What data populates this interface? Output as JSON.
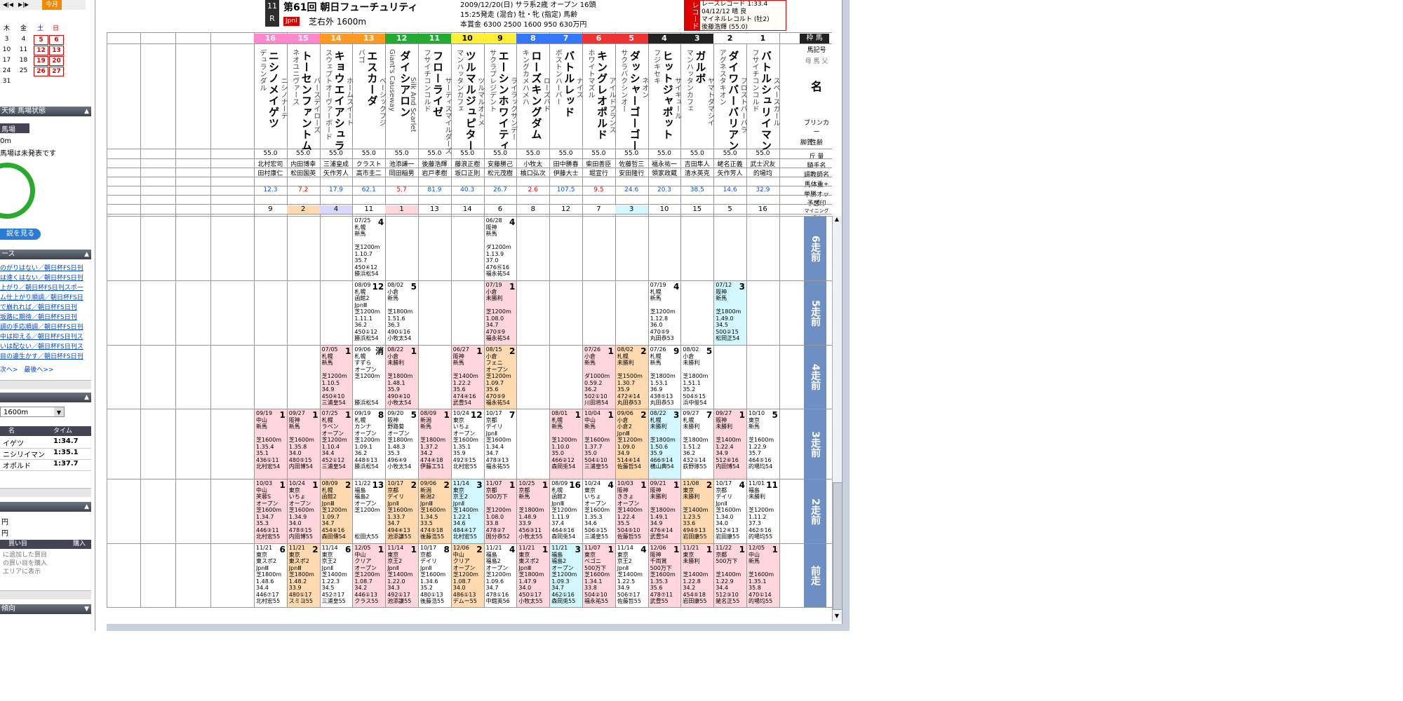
{
  "sidebar": {
    "calendar": {
      "today_label": "今月",
      "weekdays": [
        "木",
        "金",
        "土",
        "日"
      ],
      "rows": [
        [
          "3",
          "4",
          "5",
          "6"
        ],
        [
          "10",
          "11",
          "12",
          "13"
        ],
        [
          "17",
          "18",
          "19",
          "20"
        ],
        [
          "24",
          "25",
          "26",
          "27"
        ],
        [
          "31",
          "",
          "",
          ""
        ]
      ]
    },
    "track_status": {
      "title": "天候 馬場状態",
      "line1": "馬場",
      "line2": "0m",
      "line3": "馬場は未発表です",
      "video_button": "説を見る"
    },
    "news": {
      "title": "ース",
      "items": [
        "のがりはない／朝日杯FS日刊",
        "は速くはない／朝日杯FS日刊",
        "上がり／朝日杯FS日刊スポー",
        "ム仕上がり順調／朝日杯FS日",
        "で崩れれば／朝日杯FS日刊",
        "坂路に期待／朝日杯FS日刊",
        "調の手応順調／朝日杯FS日刊",
        "中は抑える／朝日杯FS日刊ス",
        "いは配ない／朝日杯FS日刊ス",
        "目の違生かす／朝日杯FS日刊"
      ],
      "next": "次へ>",
      "last": "最後へ>>"
    },
    "past_winners": {
      "distance_select": "1600m",
      "columns": [
        "名",
        "タイム"
      ],
      "rows": [
        {
          "name": "イゲツ",
          "time": "1:34.7"
        },
        {
          "name": "ニシリイマン",
          "time": "1:35.1"
        },
        {
          "name": "オポルド",
          "time": "1:37.7"
        }
      ]
    },
    "betting": {
      "yen1": "円",
      "yen2": "円",
      "col1": "買い目",
      "col2": "購入",
      "note1": "に追加した買目",
      "note2": "の買い目を購入",
      "note3": "エリアに表示"
    },
    "trend_label": "傾向"
  },
  "race": {
    "number": "11",
    "r": "R",
    "title": "第61回 朝日フューチュリティ",
    "grade": "JpnI",
    "course": "芝右外 1600m",
    "info1": "2009/12/20(日) サラ系2歳 オープン 16頭",
    "info2": "15:25発走 (混合) 牡・牝 (指定) 馬齢",
    "info3": "本賞金 6300 2500 1600 950 630万円",
    "record_label": "レコード",
    "record_line1": "レースレコード 1:33.4",
    "record_line2": "04/12/12 晴 良",
    "record_line3": "マイネルレコルト (牡2)",
    "record_line4": "後藤浩輝 (55.0)"
  },
  "header_right": {
    "waku": "枠 馬",
    "umaban": "馬記号",
    "parents": "母 馬 父",
    "name": "名",
    "blinker": "ブリンカー",
    "sex": "性齢",
    "legs": "脚質",
    "weight": "斤 量",
    "jockey": "騎手名",
    "trainer": "調教師名",
    "bodyweight": "馬体重±",
    "odds": "単勝オッズ",
    "mark": "予想印",
    "rank": "マイニング 順位"
  },
  "horses": [
    {
      "num": "16",
      "name": "ニシノメイゲツ",
      "sire": "デュランダル",
      "dam": "ニシノナーテ",
      "weight": "55.0",
      "jockey": "北村宏司",
      "trainer": "田村康仁",
      "odds": "12.3",
      "rank": "9",
      "waku": "8"
    },
    {
      "num": "15",
      "name": "トーセンファントム",
      "sire": "ネオユニヴァース",
      "dam": "バースデイローズ",
      "weight": "55.0",
      "jockey": "内田博幸",
      "trainer": "松田国英",
      "odds": "7.2",
      "rank": "2",
      "waku": "8"
    },
    {
      "num": "14",
      "name": "キョウエイアシュラ",
      "sire": "スウェプトオーヴァーボード",
      "dam": "ホームスイート",
      "weight": "55.0",
      "jockey": "三浦皇成",
      "trainer": "矢作芳人",
      "odds": "17.9",
      "rank": "4",
      "waku": "7"
    },
    {
      "num": "13",
      "name": "エスカーダ",
      "sire": "バゴ",
      "dam": "ベーシックフジ",
      "weight": "55.0",
      "jockey": "クラスト",
      "trainer": "高市圭二",
      "odds": "62.1",
      "rank": "11",
      "waku": "7"
    },
    {
      "num": "12",
      "name": "ダイシアロン",
      "sire": "Giant's Causeway",
      "dam": "Silk And Scarlet",
      "weight": "55.0",
      "jockey": "池添謙一",
      "trainer": "岡田稲男",
      "odds": "5.7",
      "rank": "1",
      "waku": "6"
    },
    {
      "num": "11",
      "name": "フローライゼ",
      "sire": "フサイチコンコルド",
      "dam": "サーティスマイルダーズ",
      "weight": "55.0",
      "jockey": "後藤浩輝",
      "trainer": "岩戸孝樹",
      "odds": "81.9",
      "rank": "13",
      "waku": "6"
    },
    {
      "num": "10",
      "name": "ツルマルジュピター",
      "sire": "マンハッタンカフェ",
      "dam": "ツルマルオトメ",
      "weight": "55.0",
      "jockey": "藤浪正樹",
      "trainer": "坂口正則",
      "odds": "40.3",
      "rank": "14",
      "waku": "5"
    },
    {
      "num": "9",
      "name": "エーシンホワイティ",
      "sire": "サクラプレジデント",
      "dam": "ライラックサンデー",
      "weight": "55.0",
      "jockey": "安藤勝己",
      "trainer": "松元茂樹",
      "odds": "26.7",
      "rank": "6",
      "waku": "5"
    },
    {
      "num": "8",
      "name": "ローズキングダム",
      "sire": "キングカメハメハ",
      "dam": "ローズバド",
      "weight": "55.0",
      "jockey": "小牧太",
      "trainer": "橋口弘次",
      "odds": "2.6",
      "rank": "8",
      "waku": "4"
    },
    {
      "num": "7",
      "name": "バトルレッド",
      "sire": "ボストンハーバー",
      "dam": "ナイス",
      "weight": "55.0",
      "jockey": "田中勝春",
      "trainer": "伊藤大士",
      "odds": "107.5",
      "rank": "12",
      "waku": "4"
    },
    {
      "num": "6",
      "name": "キングレオポルド",
      "sire": "ホワイトマズル",
      "dam": "アイルドフランス",
      "weight": "55.0",
      "jockey": "柴田善臣",
      "trainer": "堀宣行",
      "odds": "9.5",
      "rank": "7",
      "waku": "3"
    },
    {
      "num": "5",
      "name": "ダッシャーゴーゴー",
      "sire": "サクラバクシンオー",
      "dam": "ネオン",
      "weight": "55.0",
      "jockey": "佐藤哲三",
      "trainer": "安田隆行",
      "odds": "24.6",
      "rank": "3",
      "waku": "3"
    },
    {
      "num": "4",
      "name": "ヒットジャポット",
      "sire": "フジキセキ",
      "dam": "サイキュール",
      "weight": "55.0",
      "jockey": "福永祐一",
      "trainer": "領家政蔵",
      "odds": "20.3",
      "rank": "10",
      "waku": "2"
    },
    {
      "num": "3",
      "name": "ガルボ",
      "sire": "マンハッタンカフェ",
      "dam": "ヤマトダマシイ",
      "weight": "55.0",
      "jockey": "吉田隼人",
      "trainer": "清水英克",
      "odds": "38.5",
      "rank": "15",
      "waku": "2"
    },
    {
      "num": "2",
      "name": "ダイワバーバリアン",
      "sire": "アグネスタキオン",
      "dam": "フロストバーバラ",
      "weight": "55.0",
      "jockey": "蛯名正義",
      "trainer": "矢作芳人",
      "odds": "14.6",
      "rank": "5",
      "waku": "1"
    },
    {
      "num": "1",
      "name": "バトルシュリイマン",
      "sire": "フサイチコンコルド",
      "dam": "スペースガール",
      "weight": "55.0",
      "jockey": "武士沢友",
      "trainer": "的場均",
      "odds": "32.9",
      "rank": "16",
      "waku": "1"
    }
  ],
  "row_labels": [
    "6走前",
    "5走前",
    "4走前",
    "3走前",
    "2走前",
    "前走"
  ],
  "past_runs": {
    "r6": {
      "3": {
        "text": "07/25\n札幌\n新馬\n\n芝1200m\n1.10.7\n35.7\n450④12\n勝浜松54",
        "pos": "4",
        "color": "white"
      },
      "7": {
        "text": "06/28\n阪神\n新馬\n\nダ1200m\n1.13.9\n37.0\n476⑯16\n福永祐54",
        "pos": "4",
        "color": "white"
      }
    },
    "r5": {
      "3": {
        "text": "08/09\n札幌\n函館2\nJpnⅢ\n芝1200m\n1.11.1\n36.2\n450①12\n勝浜松54",
        "pos": "12",
        "color": "white"
      },
      "4": {
        "text": "08/02\n小倉\n新馬\n\n芝1800m\n1.51.6\n36.3\n490①16\n小牧太54",
        "pos": "5",
        "color": "white"
      },
      "7": {
        "text": "07/19\n小倉\n未勝利\n\n芝1200m\n1.08.0\n34.7\n470⑤9\n福永祐54",
        "pos": "1",
        "color": "pink"
      },
      "12": {
        "text": "07/19\n札幌\n新馬\n\n芝1200m\n1.12.8\n36.0\n470⑤9\n丸田恭53",
        "pos": "4",
        "color": "white"
      },
      "14": {
        "text": "07/12\n阪神\n新馬\n\n芝1800m\n1.49.0\n34.5\n500②15\n松岡正54",
        "pos": "3",
        "color": "cyan"
      }
    },
    "r4": {
      "2": {
        "text": "07/05\n札幌\n新馬\n\n芝1200m\n1.10.5\n34.9\n450④10\n三浦皇54",
        "pos": "1",
        "color": "pink"
      },
      "3": {
        "text": "09/06\n札幌\nすずら\nオープン\n芝1200m\n\n\n\n勝浜松54",
        "pos": "消",
        "color": "white"
      },
      "4": {
        "text": "08/22\n小倉\n未勝利\n\n芝1800m\n1.48.1\n35.9\n490④10\n小牧太54",
        "pos": "1",
        "color": "pink"
      },
      "6": {
        "text": "06/27\n阪神\n新馬\n\n芝1400m\n1.22.2\n35.6\n474④16\n武豊54",
        "pos": "1",
        "color": "pink"
      },
      "7": {
        "text": "08/15\n小倉\nフェニ\nオープン\n芝1200m\n1.09.7\n35.6\n470⑤9\n福永祐54",
        "pos": "2",
        "color": "orange"
      },
      "10": {
        "text": "07/26\n小倉\n新馬\n\nダ1000m\n0.59.2\n36.2\n502①10\n川田将54",
        "pos": "1",
        "color": "pink"
      },
      "11": {
        "text": "08/02\n札幌\n未勝利\n\n芝1500m\n1.30.7\n35.9\n472④14\n丸田恭53",
        "pos": "2",
        "color": "orange"
      },
      "12": {
        "text": "07/26\n札幌\n新馬\n\n芝1800m\n1.53.1\n36.9\n438⑤13\n丸田恭53",
        "pos": "9",
        "color": "white"
      },
      "13": {
        "text": "08/02\n小倉\n未勝利\n\n芝1800m\n1.51.1\n35.2\n504⑤15\n浜中俊54",
        "pos": "5",
        "color": "white"
      }
    },
    "r3": {
      "0": {
        "text": "09/19\n中山\n新馬\n\n芝1600m\n1.35.4\n35.1\n436①11\n北村宏54",
        "pos": "1",
        "color": "pink"
      },
      "1": {
        "text": "09/27\n阪神\n新馬\n\n芝1600m\n1.35.8\n34.0\n480⑤15\n内田博54",
        "pos": "1",
        "color": "pink"
      },
      "2": {
        "text": "07/25\n札幌\nラベン\nオープン\n芝1200m\n1.10.4\n34.4\n452①12\n三浦皇54",
        "pos": "1",
        "color": "pink"
      },
      "3": {
        "text": "09/19\n札幌\nカンナ\nオープン\n芝1200m\n1.09.1\n36.2\n448⑤13\n勝浜松54",
        "pos": "8",
        "color": "white"
      },
      "4": {
        "text": "09/20\n阪神\n野路菊\nオープン\n芝1800m\n1.48.3\n35.3\n496④9\n小牧太54",
        "pos": "5",
        "color": "white"
      },
      "5": {
        "text": "08/09\n新潟\n新馬\n\n芝1800m\n1.37.2\n34.2\n474④18\n伊藤工51",
        "pos": "1",
        "color": "pink"
      },
      "6": {
        "text": "10/24\n東京\nいちょ\nオープン\n芝1600m\n1.35.1\n35.9\n492⑤15\n北村宏55",
        "pos": "12",
        "color": "white"
      },
      "7": {
        "text": "10/17\n京都\nデイリ\nJpnⅡ\n芝1600m\n1.34.4\n34.7\n478③13\n福永祐55",
        "pos": "7",
        "color": "white"
      },
      "9": {
        "text": "08/01\n札幌\n新馬\n\n芝1200m\n1.10.0\n35.0\n466②12\n森岡兎54",
        "pos": "1",
        "color": "pink"
      },
      "10": {
        "text": "10/04\n中山\n新馬\n\n芝1600m\n1.37.7\n35.0\n504①10\n三浦皇55",
        "pos": "1",
        "color": "pink"
      },
      "11": {
        "text": "09/06\n小倉\n小倉2\nJpnⅢ\n芝1200m\n1.09.0\n34.9\n514④14\n佐藤哲54",
        "pos": "2",
        "color": "orange"
      },
      "12": {
        "text": "08/22\n札幌\n未勝利\n\n芝1800m\n1.50.6\n35.9\n466⑤14\n横山典54",
        "pos": "3",
        "color": "cyan"
      },
      "13": {
        "text": "09/27\n札幌\n未勝利\n\n芝1800m\n1.51.2\n36.2\n432①14\n荻野琢55",
        "pos": "7",
        "color": "white"
      },
      "14": {
        "text": "09/27\n阪神\n未勝利\n\n芝1400m\n1.22.4\n34.9\n512⑥16\n内田博54",
        "pos": "1",
        "color": "pink"
      },
      "15": {
        "text": "10/10\n東京\n新馬\n\n芝1600m\n1.22.9\n35.7\n464⑤16\n的場均54",
        "pos": "5",
        "color": "white"
      }
    },
    "r2": {
      "0": {
        "text": "10/03\n中山\n芙蓉S\nオープン\n芝1600m\n1.34.7\n35.3\n446③11\n北村宏55",
        "pos": "1",
        "color": "pink"
      },
      "1": {
        "text": "10/24\n東京\nいちょ\nオープン\n芝1600m\n1.34.9\n34.0\n478⑤15\n内田博55",
        "pos": "1",
        "color": "pink"
      },
      "2": {
        "text": "08/09\n札幌\n函館2\nJpnⅢ\n芝1200m\n1.09.7\n34.7\n454⑥16\n森田傳54",
        "pos": "2",
        "color": "orange"
      },
      "3": {
        "text": "11/22\n福島\n福島2\nオープン\n芝1200m\n\n\n\n松田大55",
        "pos": "13",
        "color": "white"
      },
      "4": {
        "text": "10/17\n京都\nデイリ\nJpnⅡ\n芝1600m\n1.33.7\n34.7\n494④13\n池添謙55",
        "pos": "2",
        "color": "orange"
      },
      "5": {
        "text": "09/06\n新潟\n新潟2\nJpnⅢ\n芝1600m\n1.34.5\n33.5\n474⑤18\n後藤浩55",
        "pos": "2",
        "color": "orange"
      },
      "6": {
        "text": "11/14\n東京\n京王2\nJpnⅡ\n芝1400m\n1.22.1\n34.6\n484④17\n北村宏55",
        "pos": "3",
        "color": "cyan"
      },
      "7": {
        "text": "11/07\n京都\n500万下\n\n芝1200m\n1.08.0\n33.8\n478②7\n国分恭52",
        "pos": "1",
        "color": "pink"
      },
      "8": {
        "text": "10/25\n京都\n新馬\n\n芝1800m\n1.48.9\n33.9\n456③11\n小牧太55",
        "pos": "1",
        "color": "pink"
      },
      "9": {
        "text": "08/09\n札幌\n函館2\nJpnⅢ\n芝1200m\n1.11.9\n37.4\n464⑤16\n森岡兎54",
        "pos": "16",
        "color": "white"
      },
      "10": {
        "text": "10/24\n東京\nいちょ\nオープン\n芝1600m\n1.35.3\n34.6\n506③15\n三浦皇55",
        "pos": "4",
        "color": "white"
      },
      "11": {
        "text": "10/03\n阪神\nききょ\nオープン\n芝1400m\n1.22.4\n35.5\n504⑤10\n佐藤哲55",
        "pos": "1",
        "color": "pink"
      },
      "12": {
        "text": "09/21\n阪神\n未勝利\n\n芝1800m\n1.49.1\n34.9\n476④14\n武豊54",
        "pos": "1",
        "color": "pink"
      },
      "13": {
        "text": "11/08\n東京\n未勝利\n\n芝1400m\n1.23.5\n33.6\n494⑤13\n岩田康55",
        "pos": "2",
        "color": "orange"
      },
      "14": {
        "text": "10/17\n京都\nデイリ\nJpnⅡ\n芝1600m\n1.34.0\n34.0\n512④13\n岩田康55",
        "pos": "4",
        "color": "white"
      },
      "15": {
        "text": "11/01\n福島\n未勝利\n\n芝1200m\n1.11.2\n37.3\n462⑤16\n的場均55",
        "pos": "11",
        "color": "white"
      }
    },
    "r1": {
      "0": {
        "text": "11/21\n東京\n東スポ2\nJpnⅢ\n芝1800m\n1.48.6\n34.4\n446⑦17\n北村宏55",
        "pos": "6",
        "color": "white"
      },
      "1": {
        "text": "11/21\n東京\n東スポ2\nJpnⅢ\n芝1800m\n1.48.2\n33.9\n480①17\nスミヨ55",
        "pos": "2",
        "color": "orange"
      },
      "2": {
        "text": "11/14\n東京\n京王2\nJpnⅡ\n芝1400m\n1.22.3\n34.5\n452⑦17\n三浦皇55",
        "pos": "6",
        "color": "white"
      },
      "3": {
        "text": "12/05\n中山\nクリア\nオープン\n芝1200m\n1.08.7\n34.2\n446①13\nクラス55",
        "pos": "1",
        "color": "pink"
      },
      "4": {
        "text": "11/14\n東京\n京王2\nJpnⅡ\n芝1400m\n1.22.0\n34.3\n492①17\n池添謙55",
        "pos": "1",
        "color": "pink"
      },
      "5": {
        "text": "10/17\n京都\nデイリ\nJpnⅡ\n芝1600m\n1.34.6\n35.2\n480①13\n後藤浩55",
        "pos": "8",
        "color": "white"
      },
      "6": {
        "text": "12/06\n中山\nクリア\nオープン\n芝1200m\n1.08.7\n34.0\n486①13\nデムー55",
        "pos": "2",
        "color": "orange"
      },
      "7": {
        "text": "11/21\n福島\n福島2\nオープン\n芝1200m\n1.09.6\n34.7\n478①16\n中舘英56",
        "pos": "4",
        "color": "white"
      },
      "8": {
        "text": "11/21\n東京\n東スポ2\nJpnⅢ\n芝1800m\n1.47.9\n34.0\n450①17\n小牧太55",
        "pos": "1",
        "color": "pink"
      },
      "9": {
        "text": "11/21\n福島\n福島2\nオープン\n芝1200m\n1.09.3\n34.7\n462①16\n森岡兎55",
        "pos": "3",
        "color": "cyan"
      },
      "10": {
        "text": "11/07\n東京\nベゴニ\n500万下\n芝1600m\n1.34.1\n33.8\n504②10\n福永祐55",
        "pos": "1",
        "color": "pink"
      },
      "11": {
        "text": "11/14\n東京\n京王2\nJpnⅡ\n芝1400m\n1.22.5\n34.9\n506⑦17\n佐藤哲55",
        "pos": "4",
        "color": "white"
      },
      "12": {
        "text": "12/06\n阪神\n千両賞\n500万下\n芝1600m\n1.35.3\n35.6\n478⑦11\n武豊55",
        "pos": "1",
        "color": "pink"
      },
      "13": {
        "text": "11/21\n東京\n未勝利\n\n芝1400m\n1.22.8\n34.2\n454⑤18\n岩田康55",
        "pos": "1",
        "color": "pink"
      },
      "14": {
        "text": "11/22\n京都\n500万下\n\n芝1400m\n1.22.9\n34.4\n512③10\n蛯名正55",
        "pos": "1",
        "color": "pink"
      },
      "15": {
        "text": "12/05\n中山\n新馬\n\n芝1600m\n1.35.1\n35.8\n470①14\n的場均55",
        "pos": "1",
        "color": "pink"
      }
    }
  },
  "colors": {
    "waku1": "#ffffff",
    "waku2": "#222222",
    "waku3": "#ee3333",
    "waku4": "#3377ff",
    "waku5": "#ffee33",
    "waku6": "#22aa33",
    "waku7": "#ff9922",
    "waku8": "#ff88cc",
    "row_label_bg": "#6e8fc4"
  }
}
